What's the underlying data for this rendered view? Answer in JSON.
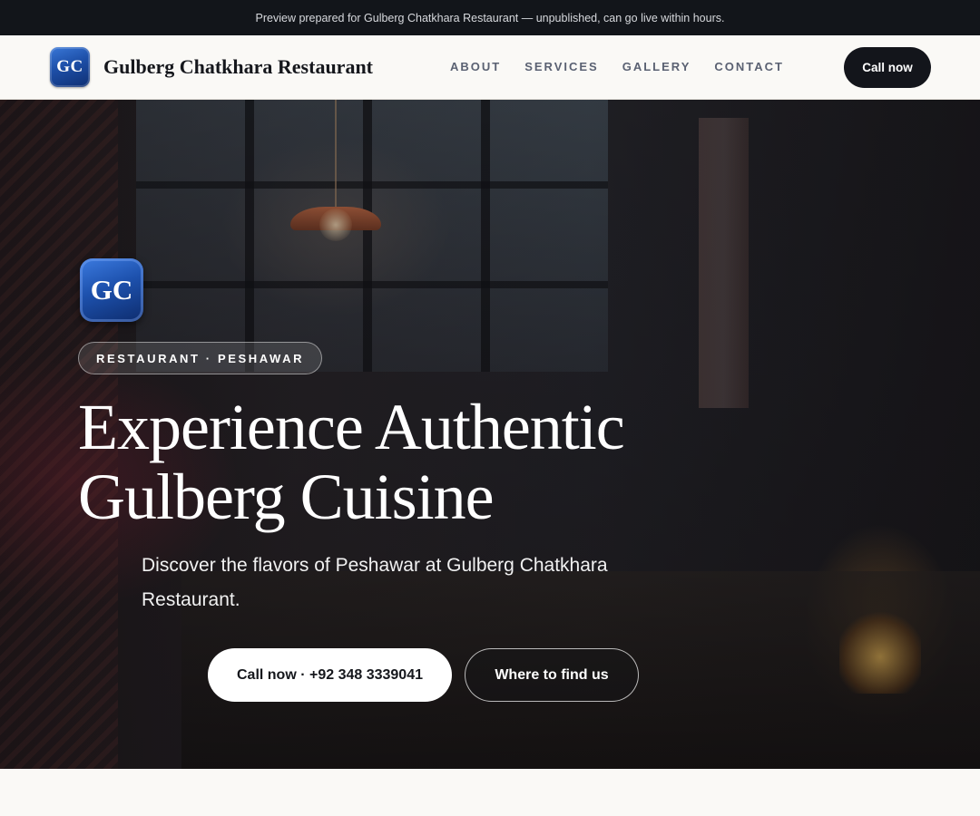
{
  "preview_banner": {
    "text": "Preview prepared for Gulberg Chatkhara Restaurant — unpublished, can go live within hours."
  },
  "header": {
    "logo_initials": "GC",
    "brand_name": "Gulberg Chatkhara Restaurant",
    "nav": [
      {
        "label": "ABOUT"
      },
      {
        "label": "SERVICES"
      },
      {
        "label": "GALLERY"
      },
      {
        "label": "CONTACT"
      }
    ],
    "call_button": "Call now"
  },
  "hero": {
    "logo_initials": "GC",
    "tag": "RESTAURANT · PESHAWAR",
    "title_line1": "Experience Authentic",
    "title_line2": "Gulberg Cuisine",
    "subtitle": "Discover the flavors of Peshawar at Gulberg Chatkhara Restaurant.",
    "call_button": "Call now · +92 348 3339041",
    "find_button": "Where to find us"
  },
  "colors": {
    "banner_bg": "#12151a",
    "header_bg": "#faf9f6",
    "primary_dark": "#13151b",
    "logo_blue": "#1d4fa8",
    "nav_text": "#5a6172"
  }
}
